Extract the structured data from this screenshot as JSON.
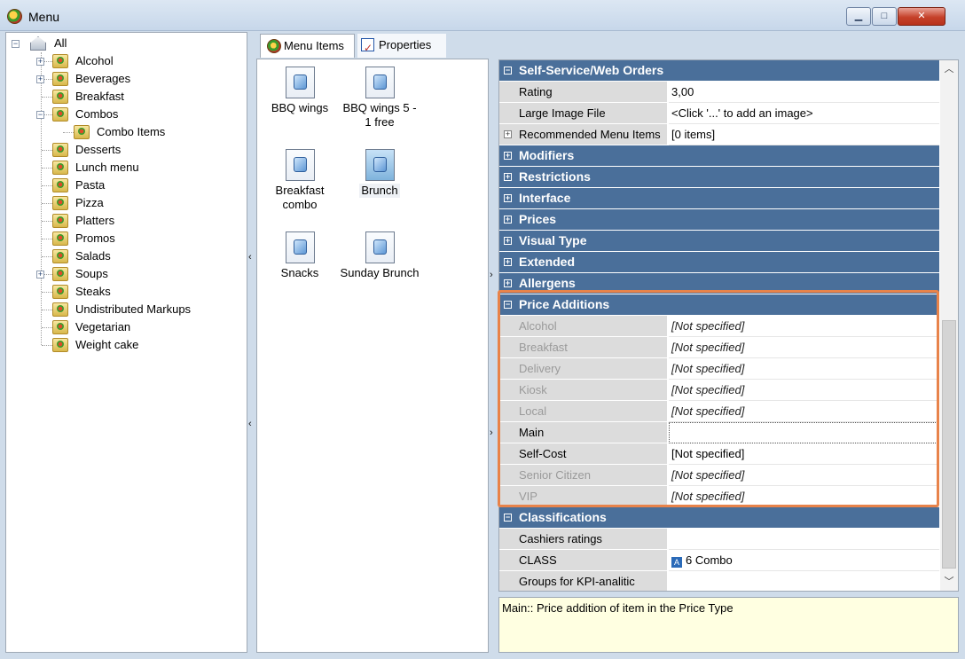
{
  "window": {
    "title": "Menu",
    "minimize_label": "▁",
    "maximize_label": "□",
    "close_label": "✕"
  },
  "tree": {
    "root": "All",
    "items": [
      {
        "label": "Alcohol",
        "expander": "+"
      },
      {
        "label": "Beverages",
        "expander": "+"
      },
      {
        "label": "Breakfast",
        "expander": ""
      },
      {
        "label": "Combos",
        "expander": "−"
      },
      {
        "label": "Combo Items",
        "expander": ""
      },
      {
        "label": "Desserts",
        "expander": ""
      },
      {
        "label": "Lunch menu",
        "expander": ""
      },
      {
        "label": "Pasta",
        "expander": ""
      },
      {
        "label": "Pizza",
        "expander": ""
      },
      {
        "label": "Platters",
        "expander": ""
      },
      {
        "label": "Promos",
        "expander": ""
      },
      {
        "label": "Salads",
        "expander": ""
      },
      {
        "label": "Soups",
        "expander": "+"
      },
      {
        "label": "Steaks",
        "expander": ""
      },
      {
        "label": "Undistributed Markups",
        "expander": ""
      },
      {
        "label": "Vegetarian",
        "expander": ""
      },
      {
        "label": "Weight cake",
        "expander": ""
      }
    ]
  },
  "tabs": [
    {
      "label": "Menu Items"
    },
    {
      "label": "Properties"
    }
  ],
  "menu_items": [
    {
      "label": "BBQ wings",
      "selected": false
    },
    {
      "label": "BBQ wings 5 - 1 free",
      "selected": false
    },
    {
      "label": "Breakfast combo",
      "selected": false
    },
    {
      "label": "Brunch",
      "selected": true
    },
    {
      "label": "Snacks",
      "selected": false
    },
    {
      "label": "Sunday Brunch",
      "selected": false
    }
  ],
  "properties": {
    "self_service": {
      "title": "Self-Service/Web Orders",
      "rows": [
        {
          "name": "Rating",
          "value": "3,00"
        },
        {
          "name": "Large Image File",
          "value": "<Click '...' to add an image>"
        },
        {
          "name": "Recommended Menu Items",
          "value": "[0 items]"
        }
      ]
    },
    "collapsed_categories": [
      "Modifiers",
      "Restrictions",
      "Interface",
      "Prices",
      "Visual Type",
      "Extended",
      "Allergens"
    ],
    "price_additions": {
      "title": "Price Additions",
      "rows": [
        {
          "name": "Alcohol",
          "value": "[Not specified]",
          "dim": true
        },
        {
          "name": "Breakfast",
          "value": "[Not specified]",
          "dim": true
        },
        {
          "name": "Delivery",
          "value": "[Not specified]",
          "dim": true
        },
        {
          "name": "Kiosk",
          "value": "[Not specified]",
          "dim": true
        },
        {
          "name": "Local",
          "value": "[Not specified]",
          "dim": true
        },
        {
          "name": "Main",
          "value": "",
          "dim": false
        },
        {
          "name": "Self-Cost",
          "value": "[Not specified]",
          "dim": false
        },
        {
          "name": "Senior Citizen",
          "value": "[Not specified]",
          "dim": true
        },
        {
          "name": "VIP",
          "value": "[Not specified]",
          "dim": true
        }
      ]
    },
    "classifications": {
      "title": "Classifications",
      "rows": [
        {
          "name": "Cashiers ratings",
          "value": ""
        },
        {
          "name": "CLASS",
          "value": "6 Combo"
        },
        {
          "name": "Groups for KPI-analitic",
          "value": ""
        }
      ]
    }
  },
  "description": "Main:: Price addition of item in the Price Type",
  "colors": {
    "category_header": "#4a6f9a",
    "highlight": "#e8834a",
    "description_bg": "#ffffe1"
  }
}
